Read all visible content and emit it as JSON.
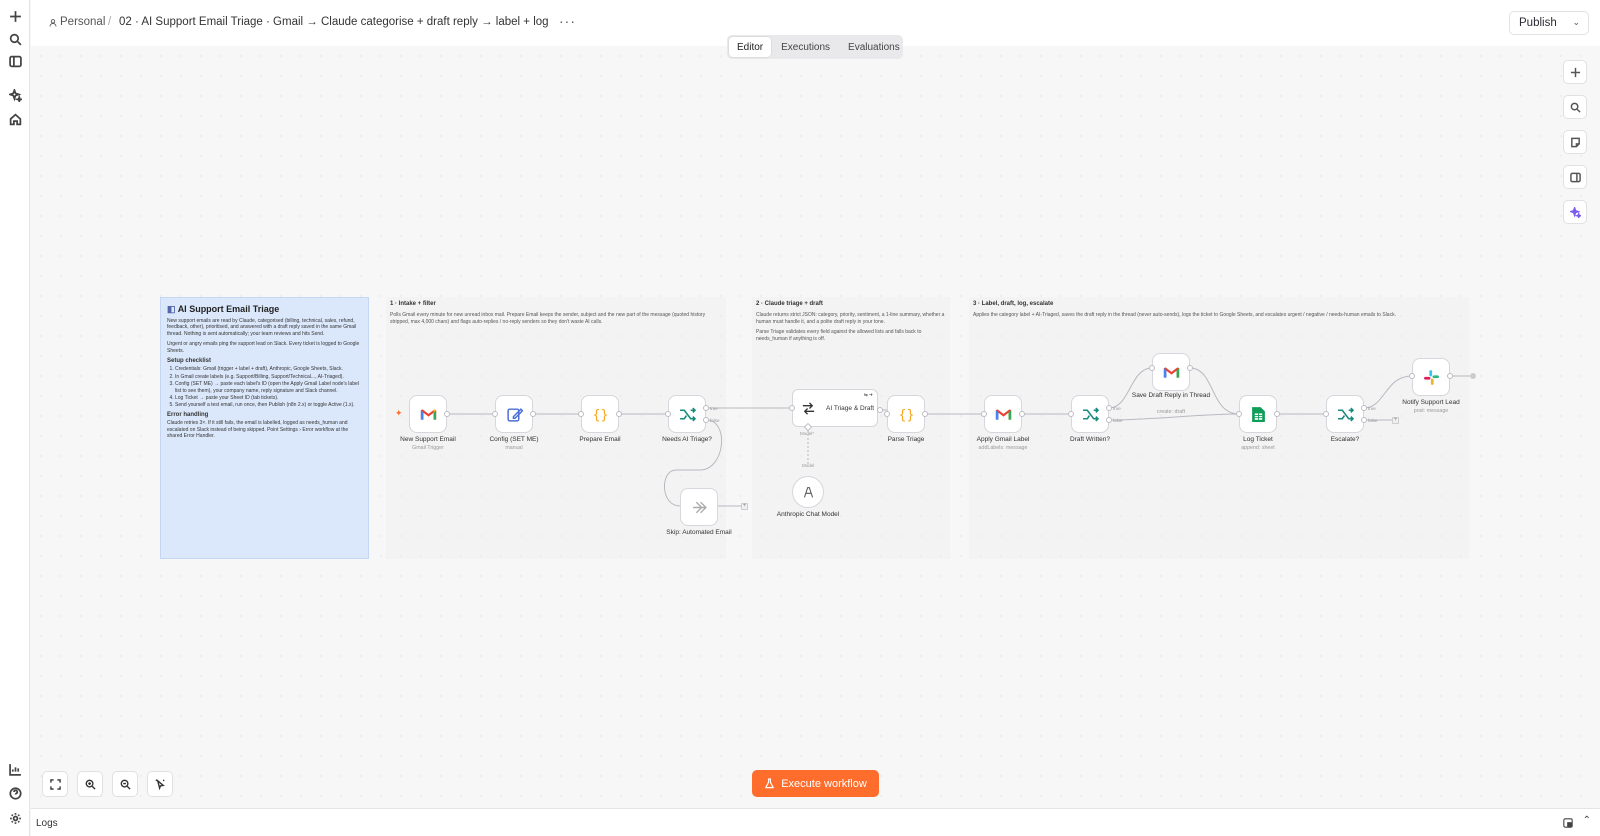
{
  "sidebar": {
    "icons_top": [
      "plus-icon",
      "search-icon",
      "panel-icon",
      "sparkle-icon",
      "home-icon"
    ],
    "icons_bottom": [
      "chart-icon",
      "help-icon",
      "settings-icon"
    ]
  },
  "breadcrumb": {
    "project": "Personal",
    "separator": "/",
    "workflow": "02 · AI Support Email Triage · Gmail → Claude categorise + draft reply → label + log",
    "more": "···"
  },
  "header": {
    "publish": "Publish"
  },
  "tabs": [
    "Editor",
    "Executions",
    "Evaluations"
  ],
  "sticky": {
    "title": "AI Support Email Triage",
    "intro": "New support emails are read by Claude, categorised (billing, technical, sales, refund, feedback, other), prioritised, and answered with a draft reply saved in the same Gmail thread. Nothing is sent automatically; your team reviews and hits Send.",
    "urgent": "Urgent or angry emails ping the support lead on Slack. Every ticket is logged to Google Sheets.",
    "setup_title": "Setup checklist",
    "setup": [
      "Credentials: Gmail (trigger + label + draft), Anthropic, Google Sheets, Slack.",
      "In Gmail create labels (e.g. Support/Billing, Support/Technical..., AI-Triaged).",
      "Config (SET ME) → paste each label's ID (open the Apply Gmail Label node's label list to see them), your company name, reply signature and Slack channel.",
      "Log Ticket → paste your Sheet ID (tab tickets).",
      "Send yourself a test email, run once, then Publish (n8n 2.x) or toggle Active (1.x)."
    ],
    "error_title": "Error handling",
    "error": "Claude retries 3×. If it still fails, the email is labelled, logged as needs_human and escalated on Slack instead of being skipped. Point Settings › Error workflow at the shared Error Handler."
  },
  "sections": [
    {
      "title": "1 · Intake + filter",
      "desc": "Polls Gmail every minute for new unread inbox mail. Prepare Email keeps the sender, subject and the new part of the message (quoted history stripped, max 4,000 chars) and flags auto-replies / no-reply senders so they don't waste AI calls."
    },
    {
      "title": "2 · Claude triage + draft",
      "desc": "Claude returns strict JSON: category, priority, sentiment, a 1-line summary, whether a human must handle it, and a polite draft reply in your tone.",
      "desc2": "Parse Triage validates every field against the allowed lists and falls back to needs_human if anything is off."
    },
    {
      "title": "3 · Label, draft, log, escalate",
      "desc": "Applies the category label + AI-Triaged, saves the draft reply in the thread (never auto-sends), logs the ticket to Google Sheets, and escalates urgent / negative / needs-human emails to Slack."
    }
  ],
  "nodes": {
    "new_support_email": {
      "label": "New Support Email",
      "sub": "Gmail Trigger"
    },
    "config": {
      "label": "Config (SET ME)",
      "sub": "manual"
    },
    "prepare_email": {
      "label": "Prepare Email"
    },
    "needs_ai_triage": {
      "label": "Needs AI Triage?",
      "true": "true",
      "false": "false"
    },
    "skip_automated": {
      "label": "Skip: Automated Email"
    },
    "ai_triage": {
      "label": "AI Triage & Draft",
      "model_port": "Model*"
    },
    "anthropic": {
      "label": "Anthropic Chat Model",
      "port": "Model"
    },
    "parse_triage": {
      "label": "Parse Triage"
    },
    "apply_label": {
      "label": "Apply Gmail Label",
      "sub": "addLabels: message"
    },
    "draft_written": {
      "label": "Draft Written?",
      "true": "true",
      "false": "false"
    },
    "save_draft": {
      "label": "Save Draft Reply in Thread",
      "sub": "create: draft"
    },
    "log_ticket": {
      "label": "Log Ticket",
      "sub": "append: sheet"
    },
    "escalate": {
      "label": "Escalate?",
      "true": "true",
      "false": "false"
    },
    "notify_lead": {
      "label": "Notify Support Lead",
      "sub": "post: message"
    }
  },
  "execute": {
    "label": "Execute workflow"
  },
  "logs": {
    "label": "Logs"
  },
  "colors": {
    "accent": "#ff6d2c",
    "sticky": "#dbe8fb",
    "gmail_red": "#ea4335",
    "sheets_green": "#0f9d58",
    "if_teal": "#178c7e",
    "code_orange": "#f5a623"
  }
}
